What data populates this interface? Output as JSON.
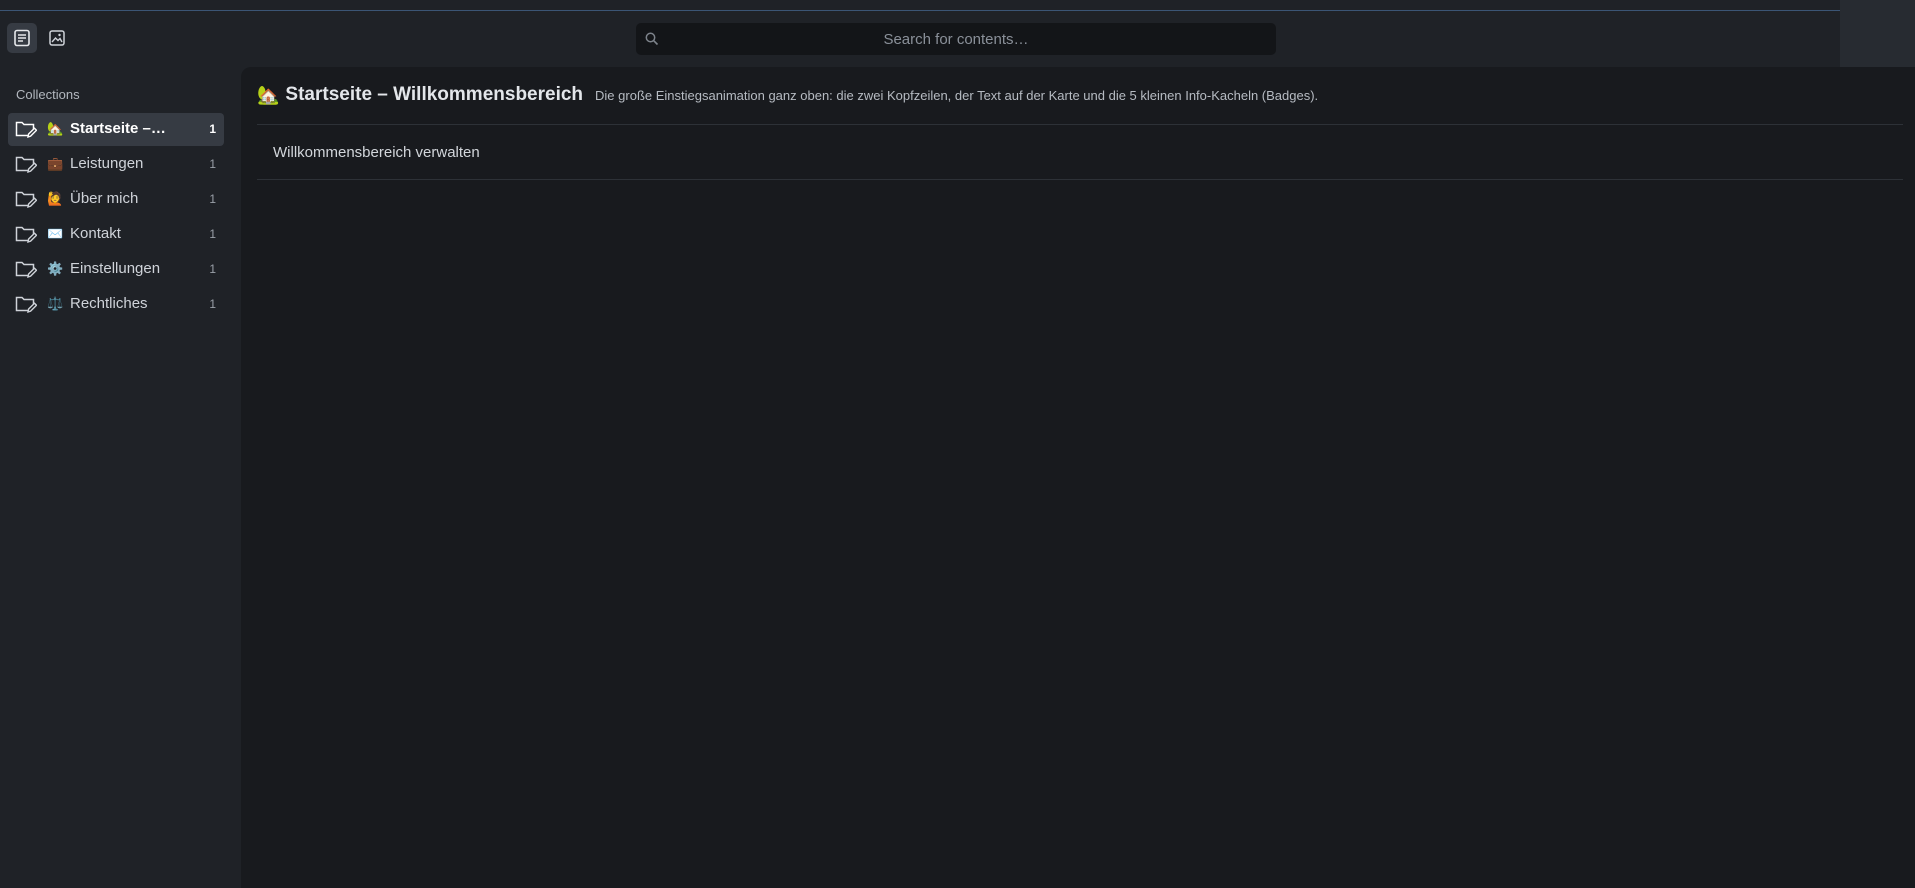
{
  "toolbar": {
    "modes": [
      {
        "name": "contents",
        "icon": "document-icon",
        "active": true
      },
      {
        "name": "media",
        "icon": "image-icon",
        "active": false
      }
    ]
  },
  "search": {
    "placeholder": "Search for contents…",
    "value": ""
  },
  "sidebar": {
    "heading": "Collections",
    "items": [
      {
        "emoji": "🏡",
        "label": "Startseite –…",
        "count": "1",
        "active": true
      },
      {
        "emoji": "💼",
        "label": "Leistungen",
        "count": "1",
        "active": false
      },
      {
        "emoji": "🙋",
        "label": "Über mich",
        "count": "1",
        "active": false
      },
      {
        "emoji": "✉️",
        "label": "Kontakt",
        "count": "1",
        "active": false
      },
      {
        "emoji": "⚙️",
        "label": "Einstellungen",
        "count": "1",
        "active": false
      },
      {
        "emoji": "⚖️",
        "label": "Rechtliches",
        "count": "1",
        "active": false
      }
    ]
  },
  "main": {
    "emoji": "🏡",
    "title": "Startseite – Willkommensbereich",
    "description": "Die große Einstiegsanimation ganz oben: die zwei Kopfzeilen, der Text auf der Karte und die 5 kleinen Info-Kacheln (Badges).",
    "entries": [
      {
        "label": "Willkommensbereich verwalten"
      }
    ]
  },
  "colors": {
    "background": "#1f2227",
    "main_background": "#181a1e",
    "active_item": "#363b43",
    "accent_line": "#3b5575"
  }
}
